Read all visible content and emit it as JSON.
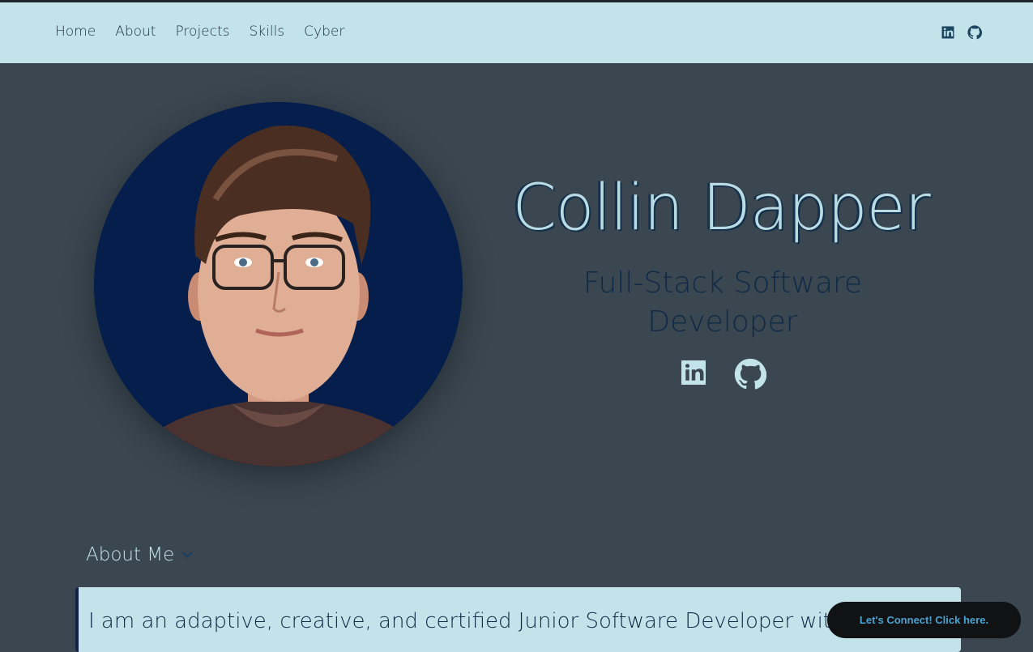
{
  "nav": {
    "links": [
      "Home",
      "About",
      "Projects",
      "Skills",
      "Cyber"
    ],
    "icons": [
      "linkedin-icon",
      "github-icon"
    ]
  },
  "hero": {
    "name": "Collin Dapper",
    "role": "Full-Stack Software Developer",
    "icons": [
      "linkedin-icon",
      "github-icon"
    ]
  },
  "about": {
    "heading": "About Me",
    "text": "I am an adaptive, creative, and certified Junior Software Developer with p"
  },
  "cta": {
    "label": "Let's Connect! Click here."
  },
  "colors": {
    "nav_bg": "#c3e3ea",
    "page_bg": "#3a4650",
    "accent_dark": "#0e2a47",
    "avatar_bg": "#051e4c",
    "button_bg": "#111214",
    "button_text": "#4aa3d2"
  }
}
